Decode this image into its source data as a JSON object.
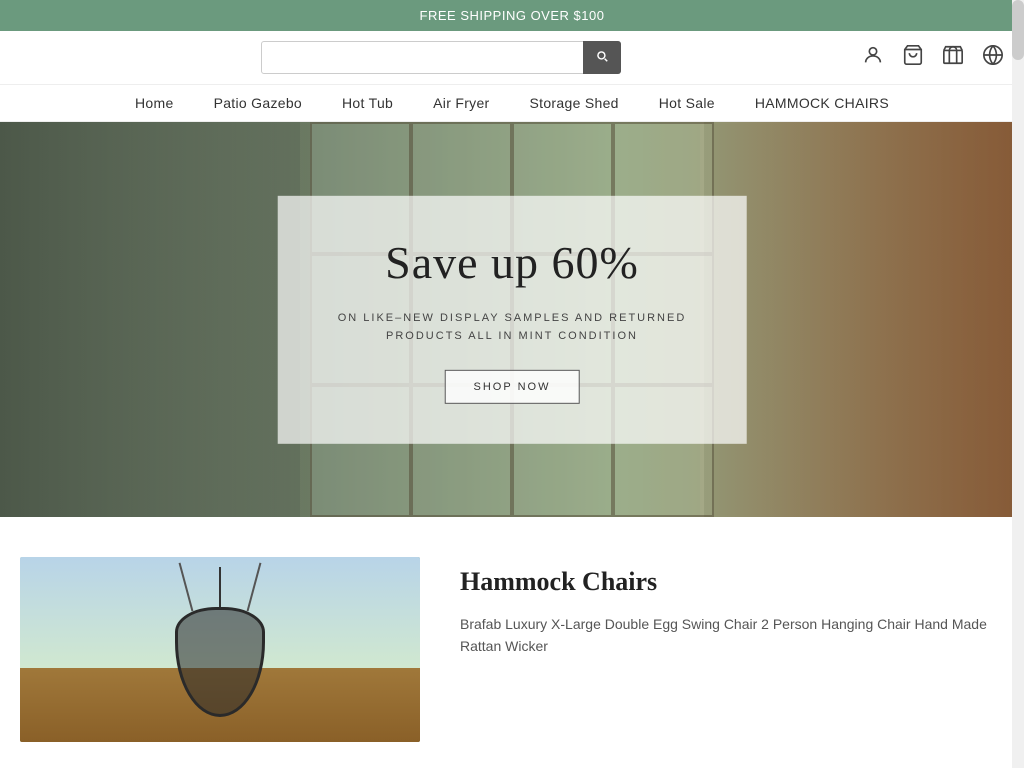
{
  "announcement": {
    "text": "FREE SHIPPING OVER $100"
  },
  "header": {
    "logo": "",
    "search_placeholder": "",
    "icons": {
      "account": "👤",
      "cart": "🛒",
      "store": "🏪",
      "language": "🌐"
    }
  },
  "nav": {
    "items": [
      {
        "label": "Home",
        "href": "#"
      },
      {
        "label": "Patio Gazebo",
        "href": "#"
      },
      {
        "label": "Hot Tub",
        "href": "#"
      },
      {
        "label": "Air Fryer",
        "href": "#"
      },
      {
        "label": "Storage Shed",
        "href": "#"
      },
      {
        "label": "Hot Sale",
        "href": "#"
      },
      {
        "label": "HAMMOCK CHAIRS",
        "href": "#"
      }
    ]
  },
  "hero": {
    "headline": "Save up 60%",
    "subtext_line1": "ON LIKE–NEW DISPLAY SAMPLES AND RETURNED",
    "subtext_line2": "PRODUCTS ALL IN MINT CONDITION",
    "cta_label": "SHOP NOW"
  },
  "products": {
    "section_title": "Hammock Chairs",
    "description": "Brafab Luxury X-Large Double Egg Swing Chair 2 Person Hanging Chair Hand Made Rattan Wicker"
  }
}
